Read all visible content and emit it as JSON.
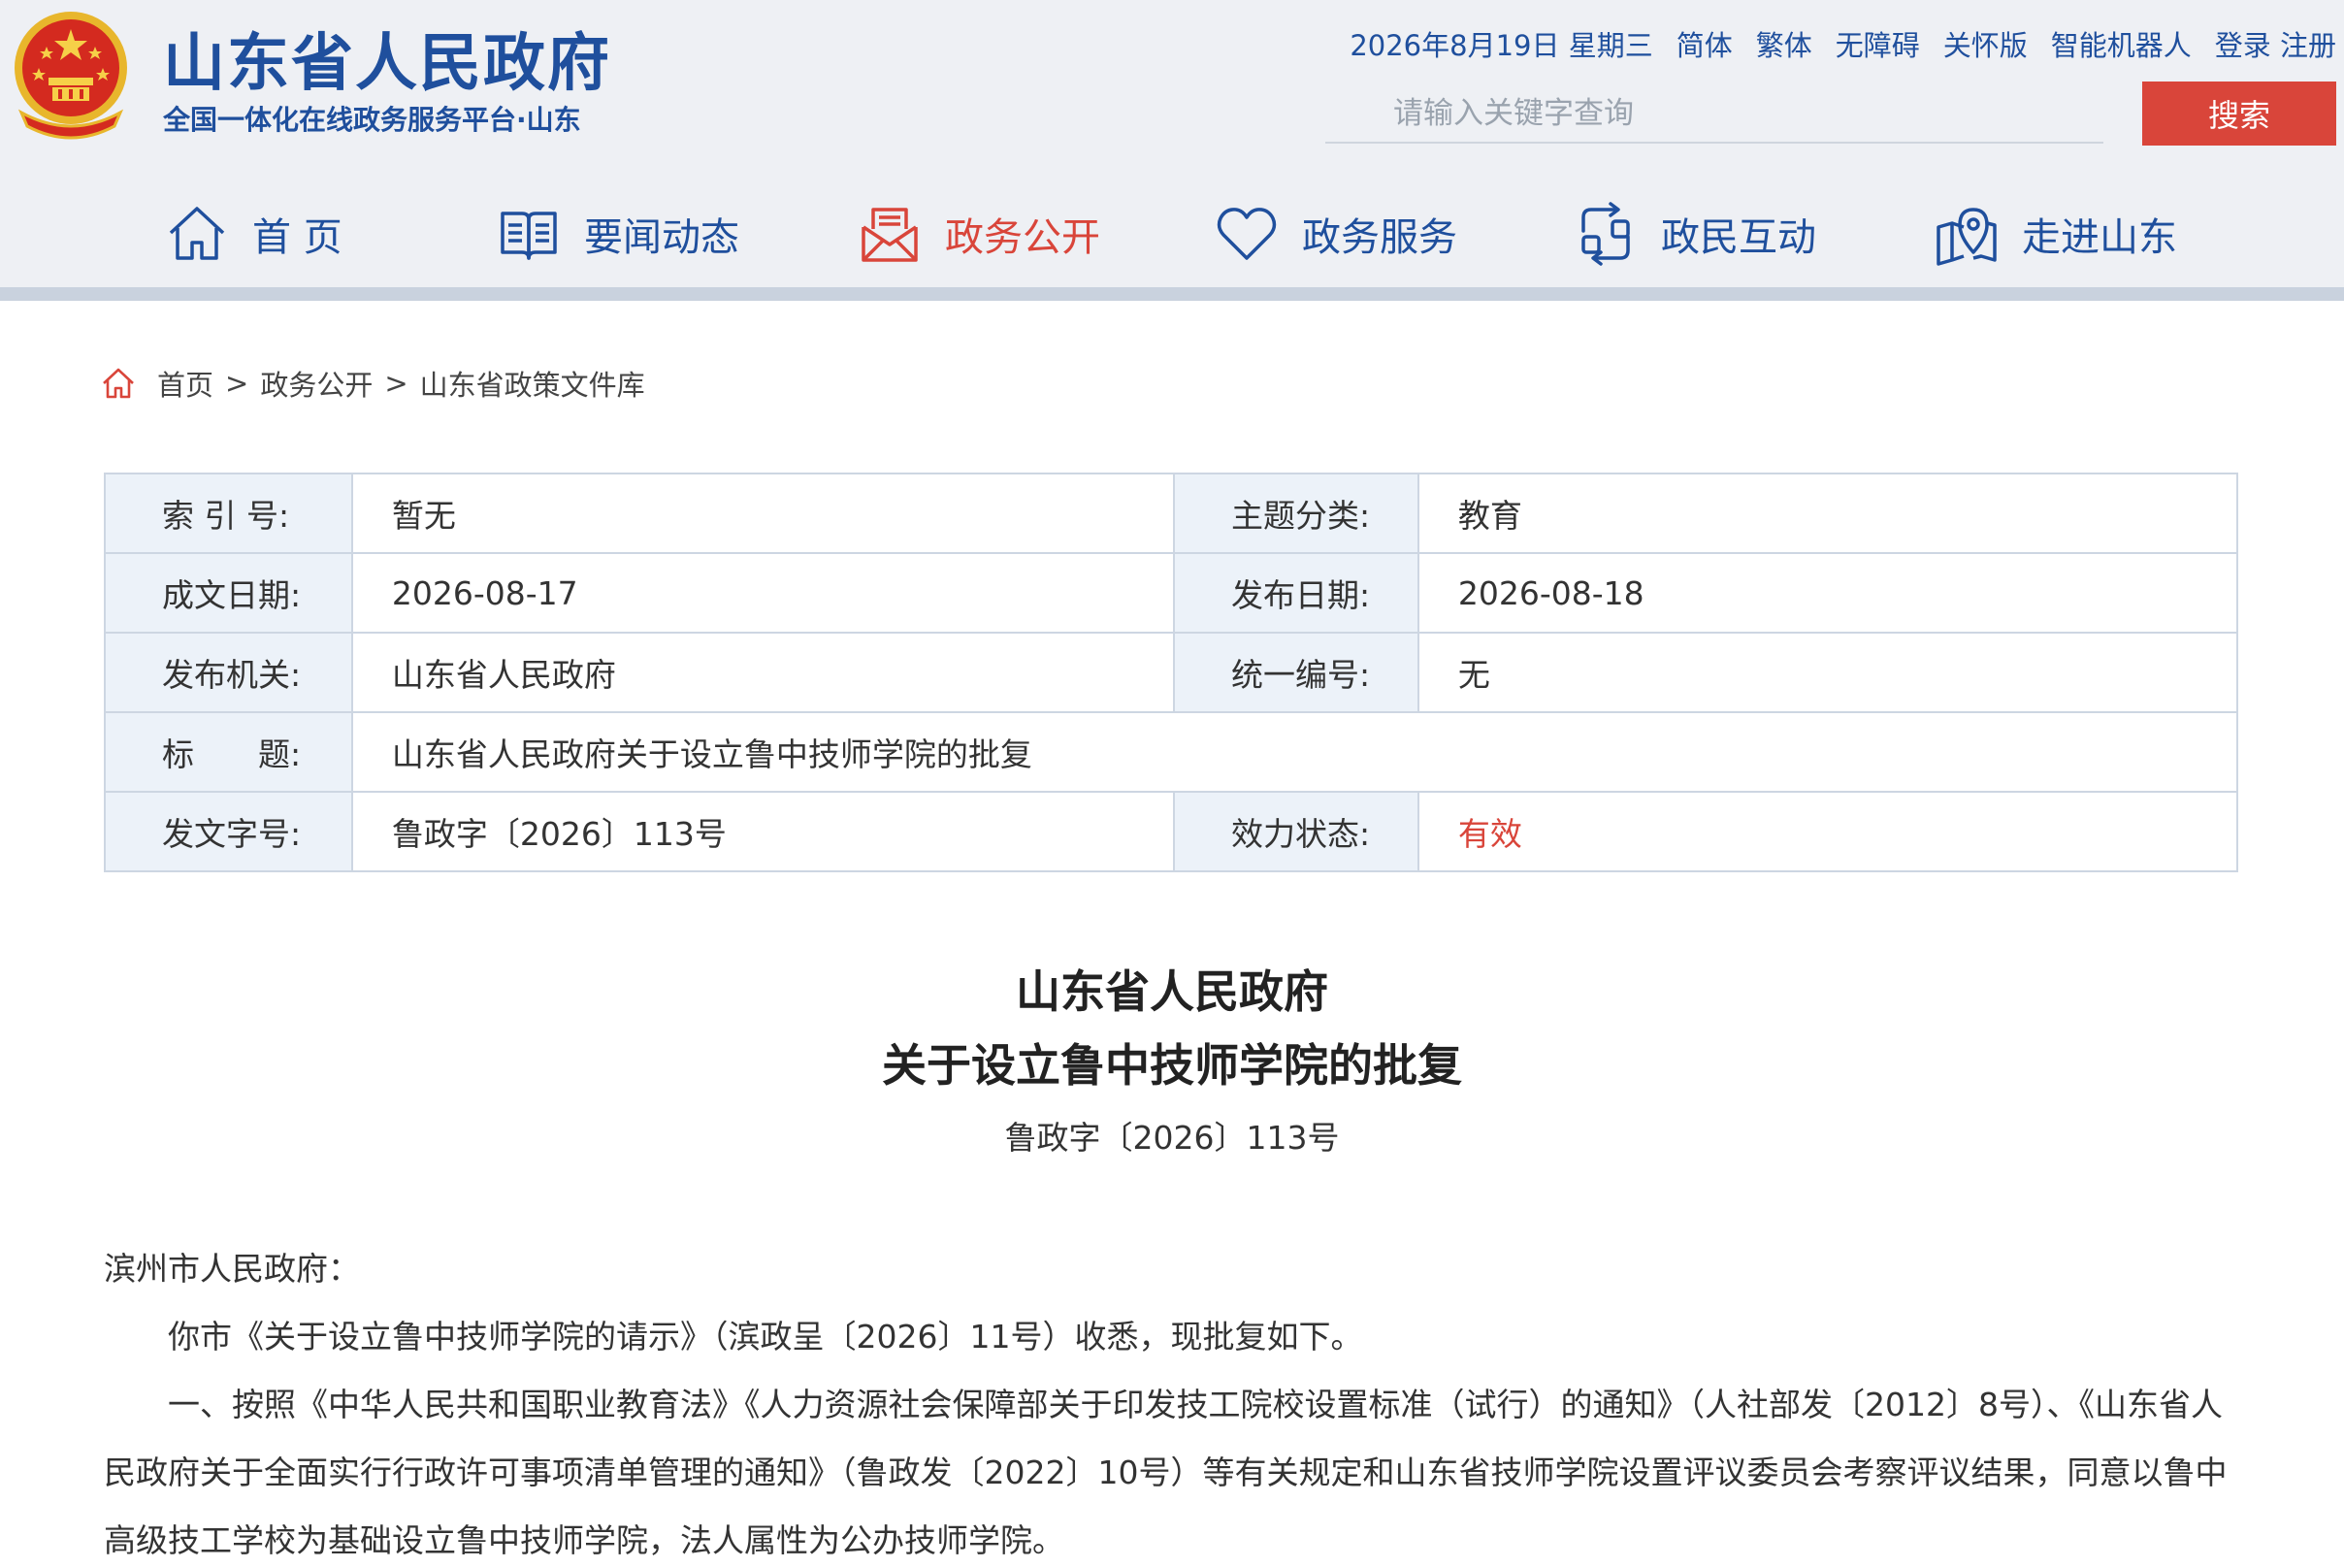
{
  "header": {
    "site_title": "山东省人民政府",
    "site_subtitle": "全国一体化在线政务服务平台·山东",
    "top_links": [
      "2026年8月19日 星期三",
      "简体",
      "繁体",
      "无障碍",
      "关怀版",
      "智能机器人",
      "登录 注册"
    ],
    "search": {
      "placeholder": "请输入关键字查询",
      "button_label": "搜索"
    },
    "colors": {
      "brand": "#1f4f9d",
      "accent": "#d9453a",
      "header_bg": "#eef0f4"
    }
  },
  "nav": {
    "items": [
      {
        "label": "首 页",
        "icon": "home-icon"
      },
      {
        "label": "要闻动态",
        "icon": "book-icon"
      },
      {
        "label": "政务公开",
        "icon": "mail-icon"
      },
      {
        "label": "政务服务",
        "icon": "heart-icon"
      },
      {
        "label": "政民互动",
        "icon": "exchange-icon"
      },
      {
        "label": "走进山东",
        "icon": "map-pin-icon"
      }
    ],
    "active_index": 2
  },
  "breadcrumb": {
    "items": [
      "首页",
      "政务公开",
      "山东省政策文件库"
    ],
    "separator": ">"
  },
  "meta": {
    "index_label": "索 引 号:",
    "index_value": "暂无",
    "topic_label": "主题分类:",
    "topic_value": "教育",
    "written_label": "成文日期:",
    "written_value": "2026-08-17",
    "published_label": "发布日期:",
    "published_value": "2026-08-18",
    "issuer_label": "发布机关:",
    "issuer_value": "山东省人民政府",
    "unified_label": "统一编号:",
    "unified_value": "无",
    "title_label": "标　　题:",
    "title_value": "山东省人民政府关于设立鲁中技师学院的批复",
    "doc_no_label": "发文字号:",
    "doc_no_value": "鲁政字〔2026〕113号",
    "status_label": "效力状态:",
    "status_value": "有效"
  },
  "document": {
    "title_line1": "山东省人民政府",
    "title_line2": "关于设立鲁中技师学院的批复",
    "number": "鲁政字〔2026〕113号",
    "salutation": "滨州市人民政府：",
    "paragraphs": [
      "你市《关于设立鲁中技师学院的请示》（滨政呈〔2026〕11号）收悉，现批复如下。",
      "一、按照《中华人民共和国职业教育法》《人力资源社会保障部关于印发技工院校设置标准（试行）的通知》（人社部发〔2012〕8号）、《山东省人民政府关于全面实行行政许可事项清单管理的通知》（鲁政发〔2022〕10号）等有关规定和山东省技师学院设置评议委员会考察评议结果，同意以鲁中高级技工学校为基础设立鲁中技师学院，法人属性为公办技师学院。"
    ]
  }
}
